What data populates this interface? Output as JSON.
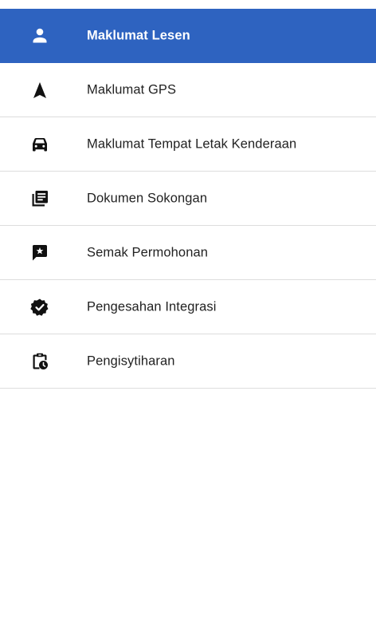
{
  "sidebar": {
    "active_color": "#2e63c0",
    "items": [
      {
        "label": "Maklumat Lesen",
        "icon": "user-icon",
        "active": true
      },
      {
        "label": "Maklumat GPS",
        "icon": "navigation-arrow-icon",
        "active": false
      },
      {
        "label": "Maklumat Tempat Letak Kenderaan",
        "icon": "car-icon",
        "active": false
      },
      {
        "label": "Dokumen Sokongan",
        "icon": "documents-icon",
        "active": false
      },
      {
        "label": "Semak Permohonan",
        "icon": "review-comment-icon",
        "active": false
      },
      {
        "label": "Pengesahan Integrasi",
        "icon": "verified-badge-icon",
        "active": false
      },
      {
        "label": "Pengisytiharan",
        "icon": "clipboard-clock-icon",
        "active": false
      }
    ]
  }
}
